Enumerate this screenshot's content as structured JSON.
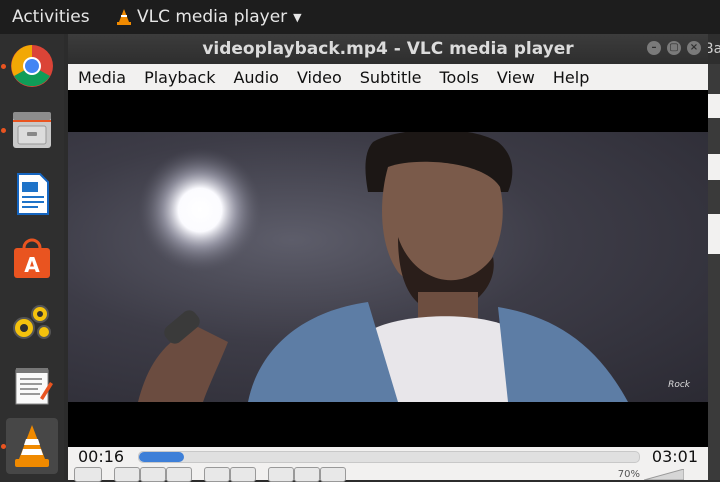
{
  "topbar": {
    "activities": "Activities",
    "app_name": "VLC media player"
  },
  "dock": {
    "items": [
      {
        "name": "chrome-icon"
      },
      {
        "name": "files-icon"
      },
      {
        "name": "writer-icon"
      },
      {
        "name": "software-center-icon"
      },
      {
        "name": "settings-icon"
      },
      {
        "name": "text-editor-icon"
      },
      {
        "name": "vlc-icon"
      }
    ]
  },
  "window": {
    "title": "videoplayback.mp4 - VLC media player",
    "menu": [
      "Media",
      "Playback",
      "Audio",
      "Video",
      "Subtitle",
      "Tools",
      "View",
      "Help"
    ]
  },
  "video": {
    "watermark": "Rock"
  },
  "playback": {
    "elapsed": "00:16",
    "total": "03:01",
    "progress_fraction": 0.09,
    "volume": "70%"
  },
  "colors": {
    "accent": "#3d7fd8",
    "ubuntu_orange": "#e95420"
  }
}
